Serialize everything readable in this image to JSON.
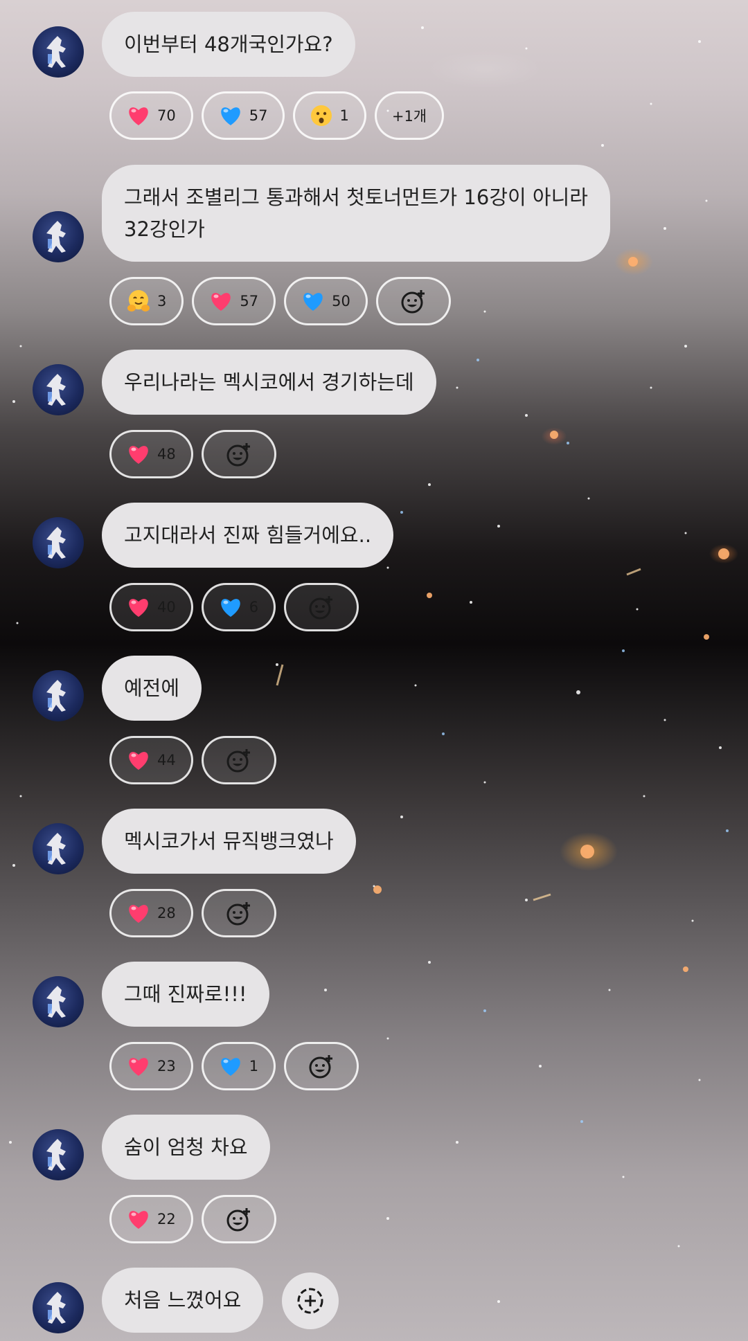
{
  "messages": [
    {
      "text": "이번부터 48개국인가요?",
      "reactions": [
        {
          "icon": "heart-red-icon",
          "count": "70"
        },
        {
          "icon": "heart-blue-icon",
          "count": "57"
        },
        {
          "icon": "surprised-face-icon",
          "count": "1"
        },
        {
          "label": "+1개"
        }
      ]
    },
    {
      "text": "그래서 조별리그 통과해서 첫토너먼트가 16강이 아니라\n32강인가",
      "reactions": [
        {
          "icon": "hug-face-icon",
          "count": "3"
        },
        {
          "icon": "heart-red-icon",
          "count": "57"
        },
        {
          "icon": "heart-blue-icon",
          "count": "50"
        },
        {
          "add": true
        }
      ]
    },
    {
      "text": "우리나라는 멕시코에서 경기하는데",
      "reactions": [
        {
          "icon": "heart-red-icon",
          "count": "48"
        },
        {
          "add": true
        }
      ]
    },
    {
      "text": "고지대라서 진짜 힘들거에요..",
      "reactions": [
        {
          "icon": "heart-red-icon",
          "count": "40"
        },
        {
          "icon": "heart-blue-icon",
          "count": "6"
        },
        {
          "add": true
        }
      ]
    },
    {
      "text": "예전에",
      "reactions": [
        {
          "icon": "heart-red-icon",
          "count": "44"
        },
        {
          "add": true
        }
      ]
    },
    {
      "text": "멕시코가서 뮤직뱅크였나",
      "reactions": [
        {
          "icon": "heart-red-icon",
          "count": "28"
        },
        {
          "add": true
        }
      ]
    },
    {
      "text": "그때 진짜로!!!",
      "reactions": [
        {
          "icon": "heart-red-icon",
          "count": "23"
        },
        {
          "icon": "heart-blue-icon",
          "count": "1"
        },
        {
          "add": true
        }
      ]
    },
    {
      "text": "숨이 엄청 차요",
      "reactions": [
        {
          "icon": "heart-red-icon",
          "count": "22"
        },
        {
          "add": true
        }
      ]
    },
    {
      "text": "처음 느꼈어요",
      "reactions": []
    }
  ],
  "colors": {
    "bubble": "#e6e4e6",
    "heart_red": "#ff3d6e",
    "heart_blue": "#1f9bff"
  }
}
